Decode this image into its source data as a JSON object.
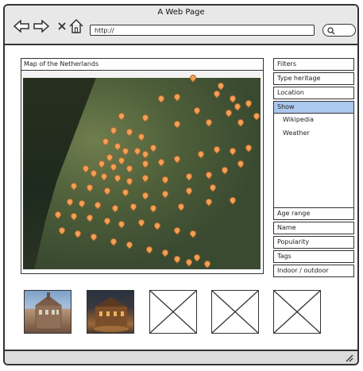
{
  "window": {
    "title": "A Web Page"
  },
  "browser": {
    "url": "http://",
    "icons": [
      "back-arrow-icon",
      "forward-arrow-icon",
      "close-x-icon",
      "home-icon",
      "search-icon"
    ]
  },
  "map": {
    "title": "Map of the Netherlands"
  },
  "sidebar": {
    "items": [
      {
        "label": "Filters"
      },
      {
        "label": "Type heritage"
      },
      {
        "label": "Location"
      },
      {
        "label": "Show"
      },
      {
        "label": "Age range"
      },
      {
        "label": "Name"
      },
      {
        "label": "Popularity"
      },
      {
        "label": "Tags"
      },
      {
        "label": "Indoor / outdoor"
      }
    ],
    "subitems": [
      {
        "label": "Wikipedia"
      },
      {
        "label": "Weather"
      }
    ]
  },
  "thumbnails": {
    "count_images": 2,
    "count_placeholders": 3
  },
  "colors": {
    "accent": "#aac8f0",
    "pin": "#f3a157",
    "titlebar": "#e8e8e8"
  }
}
